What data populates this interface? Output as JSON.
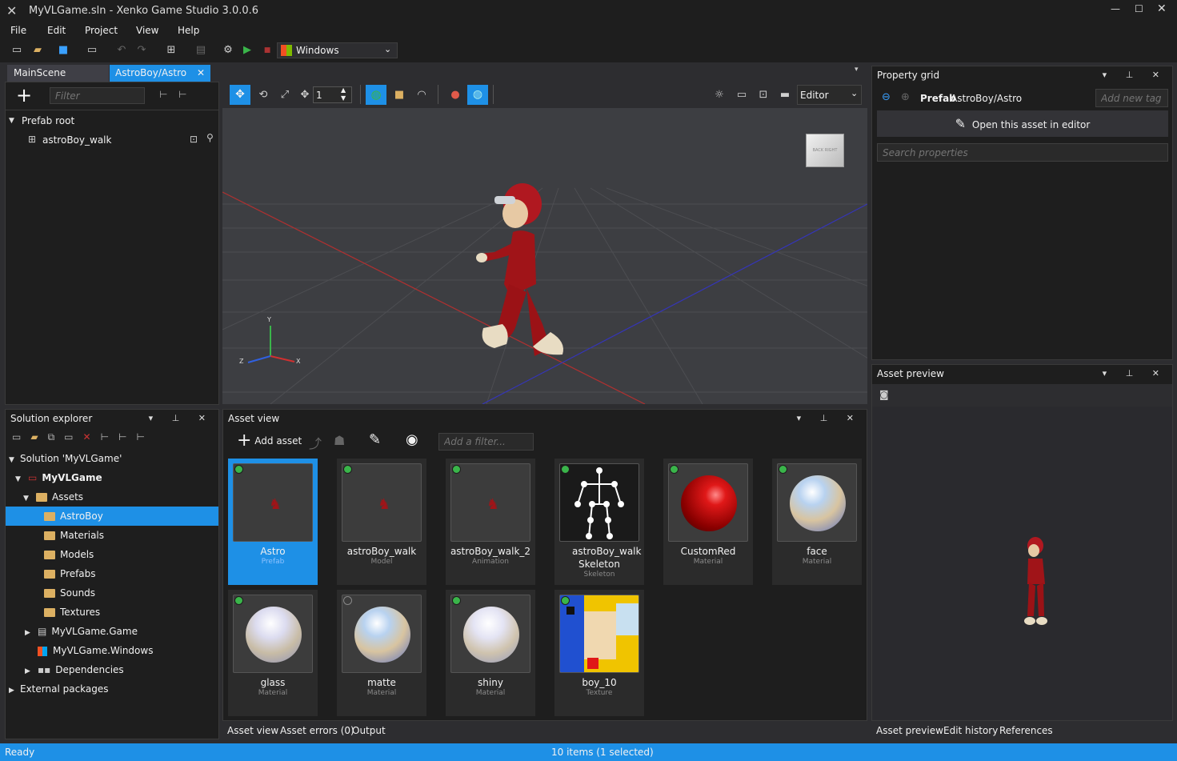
{
  "window": {
    "title": "MyVLGame.sln - Xenko Game Studio 3.0.0.6"
  },
  "menu": [
    "File",
    "Edit",
    "Project",
    "View",
    "Help"
  ],
  "toolbar": {
    "platform": "Windows"
  },
  "doc_tabs": [
    {
      "label": "MainScene",
      "active": false
    },
    {
      "label": "AstroBoy/Astro",
      "active": true
    }
  ],
  "scene_tree": {
    "filter_placeholder": "Filter",
    "root": "Prefab root",
    "child": "astroBoy_walk"
  },
  "viewport": {
    "spin_value": "1",
    "mode": "Editor",
    "axis_labels": {
      "y": "Y",
      "z": "Z",
      "x": "X"
    }
  },
  "property_grid": {
    "title": "Property grid",
    "asset_kind": "Prefab",
    "asset_path": "AstroBoy/Astro",
    "tag_placeholder": "Add new tag",
    "open_label": "Open this asset in editor",
    "search_placeholder": "Search properties"
  },
  "solution_explorer": {
    "title": "Solution explorer",
    "items": [
      {
        "label": "Solution 'MyVLGame'"
      },
      {
        "label": "MyVLGame"
      },
      {
        "label": "Assets"
      },
      {
        "label": "AstroBoy",
        "selected": true
      },
      {
        "label": "Materials"
      },
      {
        "label": "Models"
      },
      {
        "label": "Prefabs"
      },
      {
        "label": "Sounds"
      },
      {
        "label": "Textures"
      },
      {
        "label": "MyVLGame.Game"
      },
      {
        "label": "MyVLGame.Windows"
      },
      {
        "label": "Dependencies"
      },
      {
        "label": "External packages"
      }
    ]
  },
  "asset_view": {
    "title": "Asset view",
    "add_label": "Add asset",
    "filter_placeholder": "Add a filter...",
    "assets": [
      {
        "name": "Astro",
        "type": "Prefab",
        "selected": true
      },
      {
        "name": "astroBoy_walk",
        "type": "Model"
      },
      {
        "name": "astroBoy_walk_2",
        "type": "Animation"
      },
      {
        "name": "astroBoy_walk Skeleton",
        "type": "Skeleton"
      },
      {
        "name": "CustomRed",
        "type": "Material"
      },
      {
        "name": "face",
        "type": "Material"
      },
      {
        "name": "glass",
        "type": "Material"
      },
      {
        "name": "matte",
        "type": "Material"
      },
      {
        "name": "shiny",
        "type": "Material"
      },
      {
        "name": "boy_10",
        "type": "Texture"
      }
    ],
    "bottom_tabs": [
      "Asset view",
      "Asset errors (0)",
      "Output"
    ]
  },
  "asset_preview": {
    "title": "Asset preview",
    "bottom_tabs": [
      "Asset preview",
      "Edit history",
      "References"
    ]
  },
  "status": {
    "left": "Ready",
    "center": "10 items (1 selected)"
  },
  "colors": {
    "accent": "#1e90e6",
    "panel": "#1e1e1e",
    "viewport": "#3d3e42"
  }
}
